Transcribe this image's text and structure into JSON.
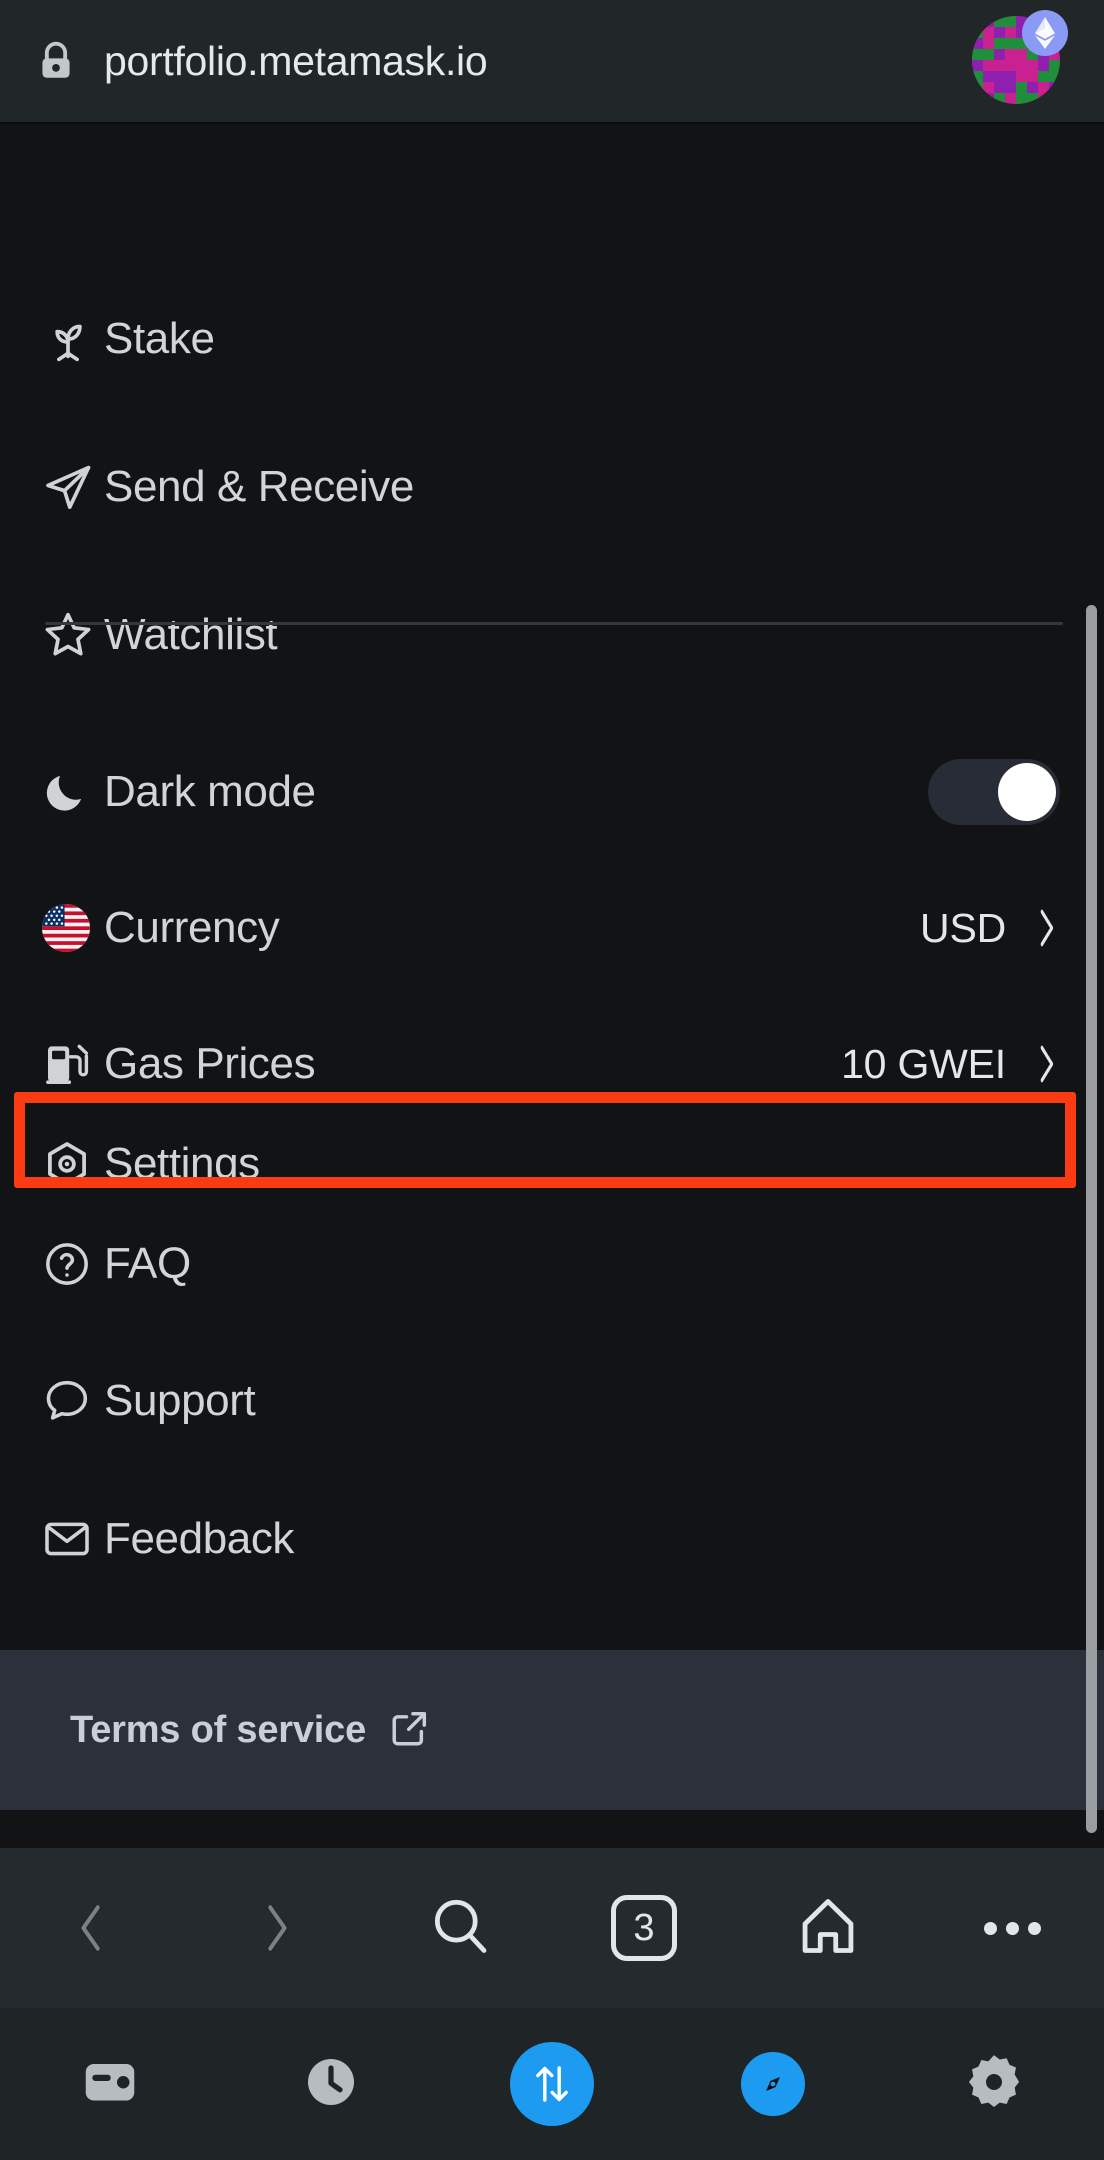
{
  "browser": {
    "url": "portfolio.metamask.io",
    "lock_icon": "lock-icon",
    "avatar": {
      "name": "account-avatar",
      "badge_icon": "ethereum-badge-icon",
      "badge_color": "#8a9af5",
      "blockie_colors": [
        "#c9218f",
        "#8f1fae",
        "#1f8f3b",
        "#e0147f"
      ]
    },
    "nav": {
      "back_label": "Back",
      "back_icon": "chevron-left-icon",
      "forward_label": "Forward",
      "forward_icon": "chevron-right-icon",
      "search_label": "Search",
      "search_icon": "search-icon",
      "tabs_label": "Tabs",
      "tabs_count": "3",
      "home_label": "Home",
      "home_icon": "home-icon",
      "more_label": "More options",
      "more_icon": "ellipsis-icon"
    }
  },
  "menu": {
    "links": [
      {
        "label": "Stake",
        "icon": "sprout-icon"
      },
      {
        "label": "Send & Receive",
        "icon": "paper-plane-icon"
      },
      {
        "label": "Watchlist",
        "icon": "star-icon"
      }
    ],
    "settings_rows": [
      {
        "label": "Dark mode",
        "icon": "moon-icon",
        "control": "toggle",
        "value": "on"
      },
      {
        "label": "Currency",
        "icon": "us-flag-icon",
        "control": "chevron",
        "value": "USD"
      },
      {
        "label": "Gas Prices",
        "icon": "gas-pump-icon",
        "control": "chevron",
        "value": "10 GWEI"
      },
      {
        "label": "Settings",
        "icon": "hexagon-gear-icon",
        "control": "none",
        "value": ""
      },
      {
        "label": "FAQ",
        "icon": "question-circle-icon",
        "control": "none",
        "value": ""
      },
      {
        "label": "Support",
        "icon": "chat-bubble-icon",
        "control": "none",
        "value": ""
      },
      {
        "label": "Feedback",
        "icon": "envelope-icon",
        "control": "none",
        "value": ""
      }
    ],
    "footer": {
      "terms_label": "Terms of service",
      "terms_icon": "external-link-icon"
    },
    "highlight": {
      "target": "Settings",
      "color": "#fb3b11"
    }
  },
  "appbar": {
    "items": [
      {
        "label": "Wallet",
        "icon": "wallet-icon",
        "active": "false"
      },
      {
        "label": "History",
        "icon": "clock-icon",
        "active": "false"
      },
      {
        "label": "Swap",
        "icon": "swap-arrows-icon",
        "active": "true"
      },
      {
        "label": "Browser",
        "icon": "compass-icon",
        "active": "true"
      },
      {
        "label": "Settings",
        "icon": "gear-icon",
        "active": "false"
      }
    ],
    "accent_color": "#1d9bf0"
  }
}
